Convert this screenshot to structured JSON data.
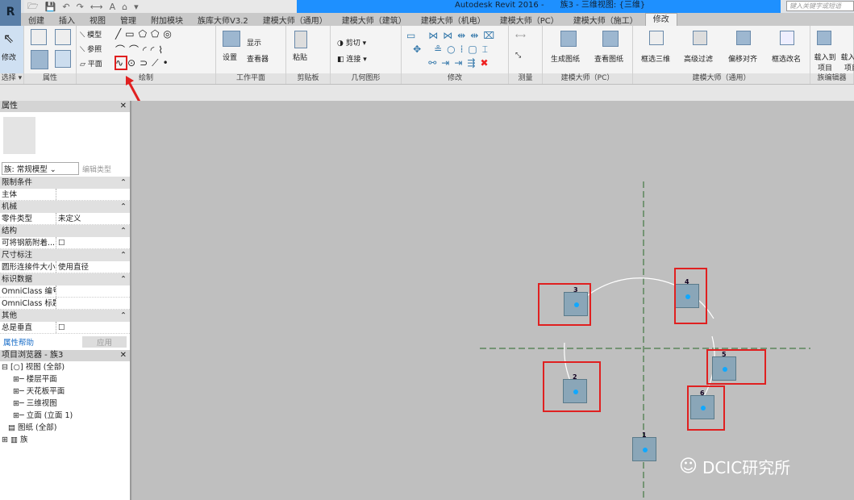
{
  "app": {
    "title": "Autodesk Revit 2016 -",
    "doc": "族3 - 三维视图: {三维}",
    "search_placeholder": "键入关键字或短语"
  },
  "tabs": [
    "创建",
    "插入",
    "视图",
    "管理",
    "附加模块",
    "族库大师V3.2",
    "建模大师（通用）",
    "建模大师（建筑）",
    "建模大师（机电）",
    "建模大师（PC）",
    "建模大师（施工）",
    "修改"
  ],
  "ribbon": {
    "modify": "修改",
    "select": "选择 ▾",
    "properties": "属性",
    "draw": {
      "model": "模型",
      "ref": "参照",
      "plane": "平面",
      "label": "绘制"
    },
    "workplane": {
      "set": "设置",
      "show": "显示",
      "viewer": "查看器",
      "label": "工作平面"
    },
    "clipboard": {
      "paste": "粘贴",
      "label": "剪贴板"
    },
    "geometry": {
      "cut": "剪切",
      "join": "连接",
      "label": "几何图形"
    },
    "modify_label": "修改",
    "measure_label": "测量",
    "pc": {
      "gen": "生成图纸",
      "view": "查看图纸",
      "label": "建模大师（PC）"
    },
    "general": {
      "a": "框选三维",
      "b": "高级过滤",
      "c": "偏移对齐",
      "d": "框选改名",
      "label": "建模大师（通用）"
    },
    "family": {
      "load": "载入到项目",
      "load2": "载入到项目",
      "label": "族编辑器"
    }
  },
  "properties": {
    "title": "属性",
    "type": "族: 常规模型",
    "edit_type": "编辑类型",
    "groups": [
      {
        "name": "限制条件",
        "rows": [
          {
            "k": "主体",
            "v": ""
          }
        ]
      },
      {
        "name": "机械",
        "rows": [
          {
            "k": "零件类型",
            "v": "未定义"
          }
        ]
      },
      {
        "name": "结构",
        "rows": [
          {
            "k": "可将钢筋附着...",
            "v": "☐"
          }
        ]
      },
      {
        "name": "尺寸标注",
        "rows": [
          {
            "k": "圆形连接件大小",
            "v": "使用直径"
          }
        ]
      },
      {
        "name": "标识数据",
        "rows": [
          {
            "k": "OmniClass 编号",
            "v": ""
          },
          {
            "k": "OmniClass 标题",
            "v": ""
          }
        ]
      },
      {
        "name": "其他",
        "rows": [
          {
            "k": "总是垂直",
            "v": "☐"
          }
        ]
      }
    ],
    "help": "属性帮助",
    "apply": "应用"
  },
  "browser": {
    "title": "项目浏览器 - 族3",
    "items": [
      "视图 (全部)",
      "楼层平面",
      "天花板平面",
      "三维视图",
      "立面 (立面 1)",
      "图纸 (全部)",
      "族"
    ]
  },
  "points": [
    "1",
    "2",
    "3",
    "4",
    "5",
    "6"
  ],
  "watermark": "DCIC研究所"
}
